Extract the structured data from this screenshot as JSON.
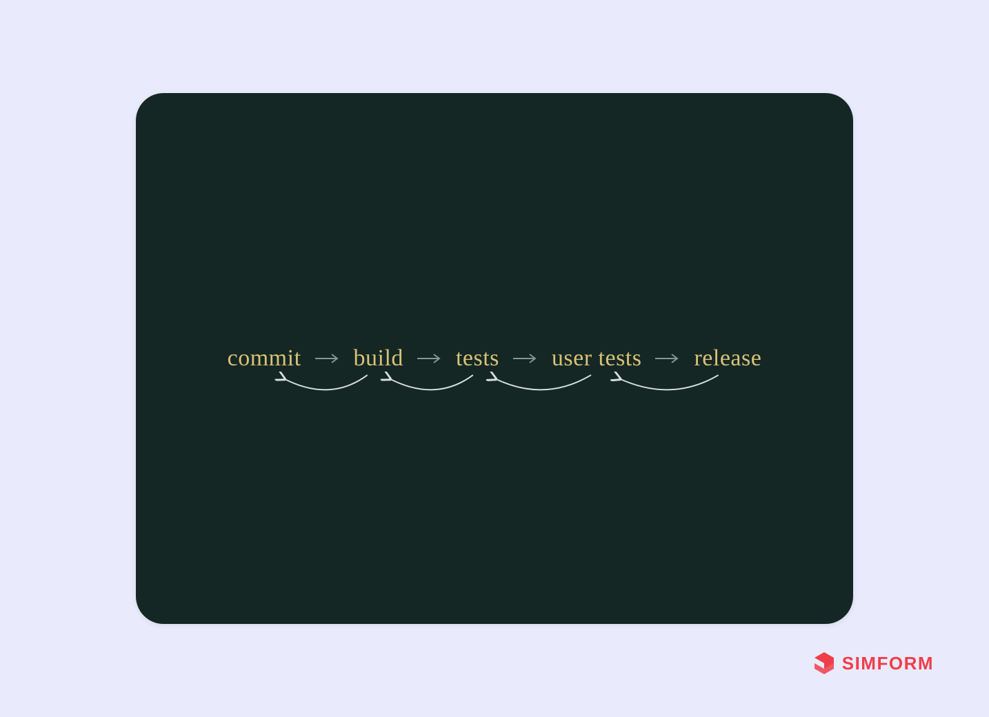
{
  "pipeline": {
    "stages": [
      {
        "label": "commit"
      },
      {
        "label": "build"
      },
      {
        "label": "tests"
      },
      {
        "label": "user tests"
      },
      {
        "label": "release"
      }
    ]
  },
  "brand": {
    "name": "SIMFORM"
  },
  "colors": {
    "background": "#eaeafd",
    "card": "#142724",
    "stage_text": "#d9c178",
    "arrow_forward": "#8a9590",
    "arrow_feedback": "#d8dedd",
    "brand": "#ef3e4a"
  }
}
